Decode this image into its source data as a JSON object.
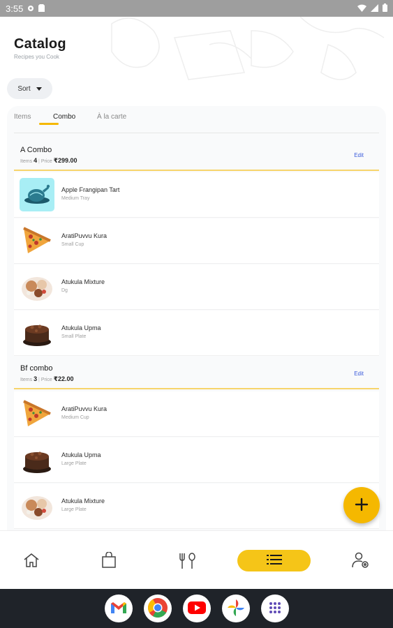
{
  "status_bar": {
    "time": "3:55"
  },
  "header": {
    "title": "Catalog",
    "subtitle": "Recipes you Cook"
  },
  "sort": {
    "label": "Sort"
  },
  "tabs": [
    {
      "label": "Items"
    },
    {
      "label": "Combo"
    },
    {
      "label": "À la carte"
    }
  ],
  "combos": [
    {
      "name": "A Combo",
      "items_label": "Items",
      "items_count": "4",
      "price_label": "Price",
      "price": "₹299.00",
      "edit_label": "Edit",
      "items": [
        {
          "name": "Apple Frangipan Tart",
          "size": "Medium Tray",
          "image": "roast-chicken-icon"
        },
        {
          "name": "AratiPuvvu Kura",
          "size": "Small Cup",
          "image": "pizza-slice-image"
        },
        {
          "name": "Atukula Mixture",
          "size": "Dg",
          "image": "dessert-plate-image"
        },
        {
          "name": "Atukula Upma",
          "size": "Small Plate",
          "image": "chocolate-cake-image"
        }
      ]
    },
    {
      "name": "Bf combo",
      "items_label": "Items",
      "items_count": "3",
      "price_label": "Price",
      "price": "₹22.00",
      "edit_label": "Edit",
      "items": [
        {
          "name": "AratiPuvvu Kura",
          "size": "Medium Cup",
          "image": "pizza-slice-image"
        },
        {
          "name": "Atukula Upma",
          "size": "Large Plate",
          "image": "chocolate-cake-image"
        },
        {
          "name": "Atukula Mixture",
          "size": "Large Plate",
          "image": "dessert-plate-image"
        }
      ]
    }
  ],
  "fab": {
    "icon": "plus-icon"
  },
  "bottom_nav": [
    {
      "icon": "home-icon"
    },
    {
      "icon": "shopping-bag-icon"
    },
    {
      "icon": "cutlery-icon"
    },
    {
      "icon": "list-icon",
      "active": true
    },
    {
      "icon": "account-settings-icon"
    }
  ],
  "dock_apps": [
    {
      "icon": "gmail-icon"
    },
    {
      "icon": "chrome-icon"
    },
    {
      "icon": "youtube-icon"
    },
    {
      "icon": "photos-icon"
    },
    {
      "icon": "apps-grid-icon"
    }
  ],
  "colors": {
    "accent": "#f5b800",
    "edit_link": "#3b5bdb",
    "system_bar": "#1f2329"
  }
}
